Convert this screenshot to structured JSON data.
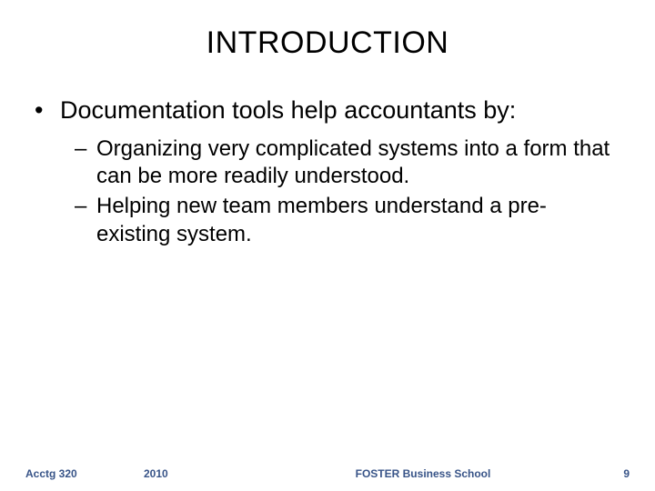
{
  "title": "INTRODUCTION",
  "main_bullet": "Documentation tools help accountants by:",
  "sub_bullets": [
    "Organizing very complicated systems into a form that can be more readily understood.",
    "Helping new team members understand a pre-existing system."
  ],
  "footer": {
    "course": "Acctg 320",
    "year": "2010",
    "school": "FOSTER Business School",
    "page": "9"
  }
}
